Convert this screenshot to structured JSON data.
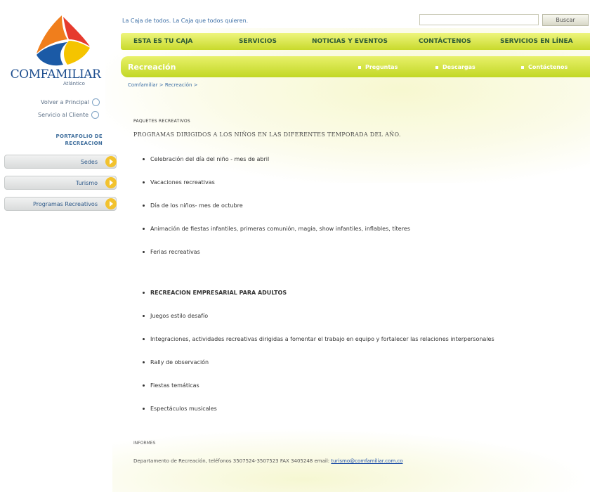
{
  "header": {
    "tagline": "La Caja de todos. La Caja que todos quieren.",
    "search_placeholder": "",
    "search_button": "Buscar"
  },
  "logo": {
    "name": "COMFAMILIAR",
    "subtitle": "Atlántico"
  },
  "nav": {
    "items": [
      "ESTA ES TU CAJA",
      "SERVICIOS",
      "NOTICIAS Y EVENTOS",
      "CONTÁCTENOS",
      "SERVICIOS EN LÍNEA"
    ]
  },
  "subnav": {
    "title": "Recreación",
    "links": [
      "Preguntas",
      "Descargas",
      "Contáctenos"
    ]
  },
  "breadcrumb": "Comfamiliar > Recreación >",
  "sidebar": {
    "links": [
      "Volver a Principal",
      "Servicio al Cliente"
    ],
    "portfolio_title_1": "PORTAFOLIO DE",
    "portfolio_title_2": "RECREACION",
    "buttons": [
      "Sedes",
      "Turismo",
      "Programas Recreativos"
    ]
  },
  "content": {
    "section_label": "PAQUETES RECREATIVOS",
    "title": "PROGRAMAS DIRIGIDOS A LOS NIÑOS EN LAS DIFERENTES TEMPORADA DEL AÑO.",
    "kids_items": [
      "Celebración del día del niño - mes de abril",
      "Vacaciones recreativas",
      "Día de los niños- mes de  octubre",
      "Animación de fiestas infantiles, primeras comunión, magia, show infantiles, inflables, títeres",
      "Ferias recreativas"
    ],
    "adults_heading": "RECREACION EMPRESARIAL PARA ADULTOS",
    "adult_items": [
      "Juegos estilo desafío",
      "Integraciones, actividades recreativas dirigidas a fomentar el trabajo en equipo y fortalecer las relaciones interpersonales",
      "Rally de observación",
      "Fiestas temáticas",
      "Espectáculos musicales"
    ]
  },
  "footer": {
    "label": "INFORMES",
    "text": "Departamento de Recreación, teléfonos 3507524-3507523 FAX 3405248 email: ",
    "email": "turismo@comfamiliar.com.co"
  },
  "colors": {
    "brand_blue": "#1d4e8f",
    "nav_green": "#c8da2c",
    "arrow_yellow": "#f2c22e"
  }
}
